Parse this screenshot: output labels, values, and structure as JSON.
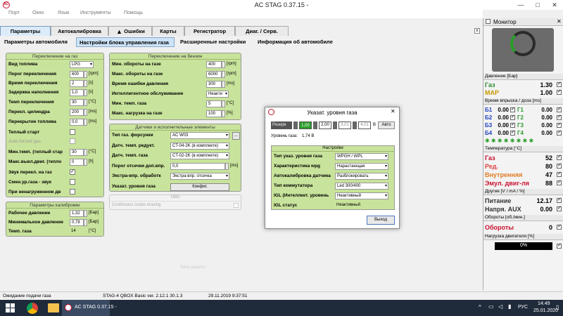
{
  "window": {
    "title": "AC STAG 0.37.15 -",
    "minimize": "—",
    "maximize": "□",
    "close": "✕"
  },
  "menu": [
    "Порт",
    "Окно",
    "Язык",
    "Инструменты",
    "Помощь"
  ],
  "main_tabs": [
    "Параметры",
    "Автокалибровка",
    "Ошибки",
    "Карты",
    "Регистратор",
    "Диаг. / Серв."
  ],
  "sub_tabs": [
    "Параметры автомобиля",
    "Настройки блока управления газа",
    "Расширенные настройки",
    "Информация об автомобиле"
  ],
  "gas_switch": {
    "header": "Переключение на газ",
    "rows": [
      {
        "label": "Вид топлива",
        "value": "LPG",
        "type": "select"
      },
      {
        "label": "Порог переключения",
        "value": "600",
        "unit": "[rpm]"
      },
      {
        "label": "Время переключения",
        "value": "2",
        "unit": "[s]"
      },
      {
        "label": "Задержка наполнения",
        "value": "1,0",
        "unit": "[s]"
      },
      {
        "label": "Темп переключения",
        "value": "30",
        "unit": "[°C]"
      },
      {
        "label": "Перекл. цилиндра",
        "value": "200",
        "unit": "[ms]"
      },
      {
        "label": "Перекрытие топлива",
        "value": "0,0",
        "unit": "[ms]"
      },
      {
        "label": "Теплый старт",
        "type": "checkbox",
        "checked": false
      },
      {
        "label": "Auto-forced gas",
        "type": "checkbox",
        "checked": false,
        "dim": true
      },
      {
        "label": "Мин.темп. (теплый стар",
        "value": "30",
        "unit": "[°C]"
      },
      {
        "label": "Макс.выкл.двиг. (тепло",
        "value": "0",
        "unit": "[h]"
      },
      {
        "label": "Звук перекл. на газ",
        "type": "checkbox",
        "checked": true
      },
      {
        "label": "Смен.ур.газа - звук",
        "type": "checkbox",
        "checked": false
      },
      {
        "label": "При ненагруженном дв",
        "type": "checkbox",
        "checked": false
      }
    ]
  },
  "calib": {
    "header": "Параметры калибровки",
    "rows": [
      {
        "label": "Рабочее давление",
        "value": "1,32",
        "unit": "[Бар]"
      },
      {
        "label": "Минимальное давление",
        "value": "0,78",
        "unit": "[Бар]"
      },
      {
        "label": "Темп. газа",
        "value": "14",
        "unit": "[°C]"
      }
    ]
  },
  "petrol_switch": {
    "header": "Переключение на бензин",
    "rows": [
      {
        "label": "Мин. обороты на газе",
        "value": "400",
        "unit": "[rpm]"
      },
      {
        "label": "Макс. обороты на газе",
        "value": "6000",
        "unit": "[rpm]"
      },
      {
        "label": "Время ошибки давления",
        "value": "300",
        "unit": "[ms]"
      },
      {
        "label": "Интеллигентное обслуживание",
        "value": "Неакти",
        "type": "select"
      },
      {
        "label": "Мин. темп. газа",
        "value": "5",
        "unit": "[°C]"
      },
      {
        "label": "Макс. нагрузка на газе",
        "value": "100",
        "unit": "[%]"
      }
    ]
  },
  "sensors": {
    "header": "Датчики и исполнительные элементы",
    "rows": [
      {
        "label": "Тип газ. форсунки",
        "value": "AC W03",
        "type": "select"
      },
      {
        "label": "Датч. темп. редукт.",
        "value": "CT-04-2K (в комплекте)",
        "type": "select"
      },
      {
        "label": "Датч. темп. газа",
        "value": "CT-02-2K (в комплекте)",
        "type": "select"
      },
      {
        "label": "Порог отсечки доп.впр.",
        "value": "0,0",
        "unit": "[ms]"
      },
      {
        "label": "Экстра-впр. обработк",
        "value": "Экстра-впр. отсечка",
        "type": "select"
      },
      {
        "label": "Указат. уровня газа",
        "value": "Конфиг.",
        "type": "button"
      }
    ]
  },
  "obd": {
    "header": "OBD",
    "label": "Continuous codes erasing"
  },
  "faint_text": "Save params",
  "dialog": {
    "title": "Указат. уровня газа",
    "reserve": "Резерв",
    "levels": [
      "1,00",
      "2,00",
      "3,01",
      "4,01"
    ],
    "unit": "В",
    "auto": "Авто",
    "gas_level_label": "Уровень газа:",
    "gas_level_value": "1,74 В",
    "settings_header": "Настройки",
    "settings": [
      {
        "label": "Тип указ. уровня газа",
        "value": "WPGH / WPL"
      },
      {
        "label": "Характеристика wpg",
        "value": "Нарастающая"
      },
      {
        "label": "Автокалибровка датчика",
        "value": "Разблокировать"
      },
      {
        "label": "Тип коммутатора",
        "value": "Led 300/400"
      },
      {
        "label": "IGL (Интеллект. уровень",
        "value": "Неактивный"
      },
      {
        "label": "IGL статус",
        "value": "Неактивный"
      }
    ],
    "exit": "Выход"
  },
  "monitor": {
    "title": "Монитор",
    "pressure_title": "Давление [Бар]",
    "pressure": [
      {
        "label": "Газ",
        "value": "1.30",
        "color": "#2e8b2e"
      },
      {
        "label": "MAP",
        "value": "1.00",
        "color": "#c89600"
      }
    ],
    "inj_title": "Время впрыска / доза [ms]",
    "inj": [
      {
        "b": "Б1",
        "bv": "0.00",
        "g": "Г1",
        "gv": "0.00"
      },
      {
        "b": "Б2",
        "bv": "0.00",
        "g": "Г2",
        "gv": "0.00"
      },
      {
        "b": "Б3",
        "bv": "0.00",
        "g": "Г3",
        "gv": "0.00"
      },
      {
        "b": "Б4",
        "bv": "0.00",
        "g": "Г4",
        "gv": "0.00"
      }
    ],
    "temp_title": "Температура [°C]",
    "temps": [
      {
        "label": "Газ",
        "value": "52",
        "color": "#c8102e"
      },
      {
        "label": "Ред.",
        "value": "80",
        "color": "#d44"
      },
      {
        "label": "Внутренняя",
        "value": "47",
        "color": "#e07a20"
      },
      {
        "label": "Эмул. двиг-ля",
        "value": "88",
        "color": "#c8102e"
      }
    ],
    "other_title": "Другие [V / mA / %]",
    "other": [
      {
        "label": "Питание",
        "value": "12.17"
      },
      {
        "label": "Напря. AUX",
        "value": "0.00"
      }
    ],
    "rpm_title": "Обороты [об./мин.]",
    "rpm": {
      "label": "Обороты",
      "value": "0"
    },
    "load_title": "Нагрузка двигателя [%]",
    "load_value": "0%",
    "load_fraction": 0
  },
  "status": {
    "left": "Ожидание подачи газа",
    "mid": "STAG-4 QBOX Basic  ver. 2.12.1  30.1.3",
    "date": "29.11.2019 9:37:51"
  },
  "taskbar": {
    "app": "AC STAG 0.37.15 -",
    "lang": "РУС",
    "time": "14:49",
    "date": "25.01.2020"
  }
}
